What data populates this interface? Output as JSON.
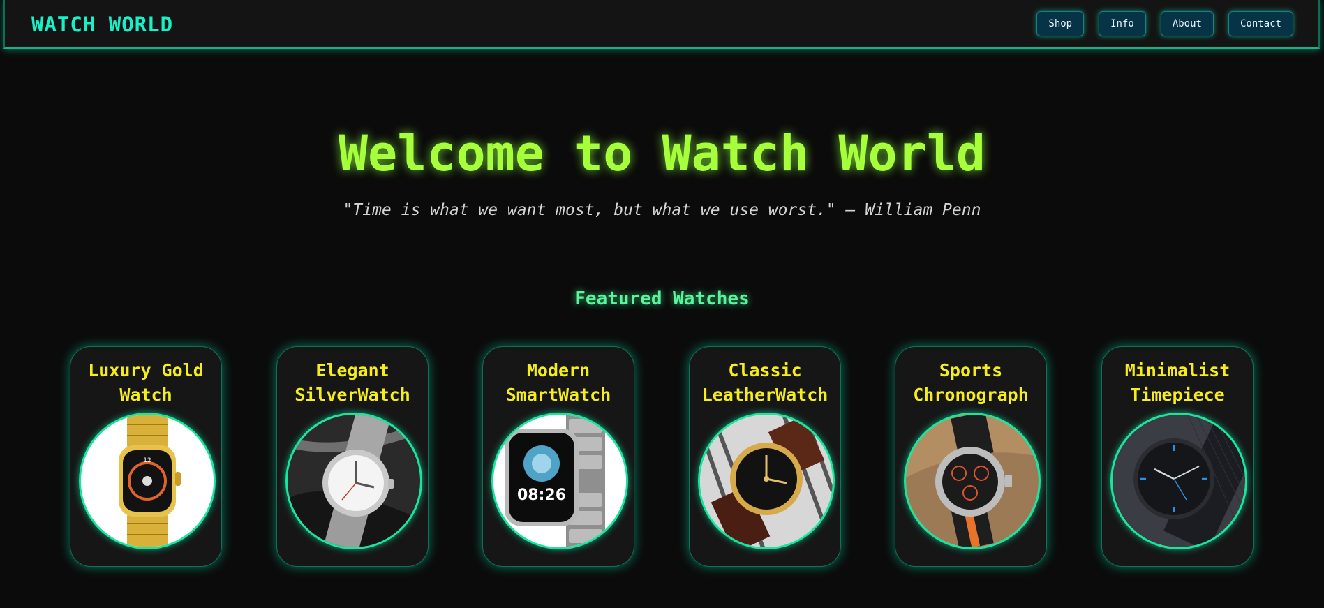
{
  "brand": "WATCH WORLD",
  "nav": [
    "Shop",
    "Info",
    "About",
    "Contact"
  ],
  "hero": {
    "title": "Welcome to Watch World",
    "quote": "\"Time is what we want most, but what we use worst.\" — William Penn"
  },
  "featured": {
    "title": "Featured Watches",
    "watches": [
      {
        "name": "Luxury Gold\nWatch",
        "icon": "gold-watch-image"
      },
      {
        "name": "Elegant\nSilverWatch",
        "icon": "silver-watch-image"
      },
      {
        "name": "Modern\nSmartWatch",
        "icon": "smartwatch-image",
        "display_time": "08:26"
      },
      {
        "name": "Classic\nLeatherWatch",
        "icon": "leather-watch-image"
      },
      {
        "name": "Sports\nChronograph",
        "icon": "chronograph-image"
      },
      {
        "name": "Minimalist\nTimepiece",
        "icon": "minimalist-watch-image"
      }
    ]
  },
  "colors": {
    "background": "#0b0b0b",
    "brand": "#19f0c8",
    "hero": "#a6ff3a",
    "section": "#5bf39c",
    "card_title": "#f6ee1c",
    "nav_button": "#073347",
    "accent_glow": "#19e69a"
  }
}
